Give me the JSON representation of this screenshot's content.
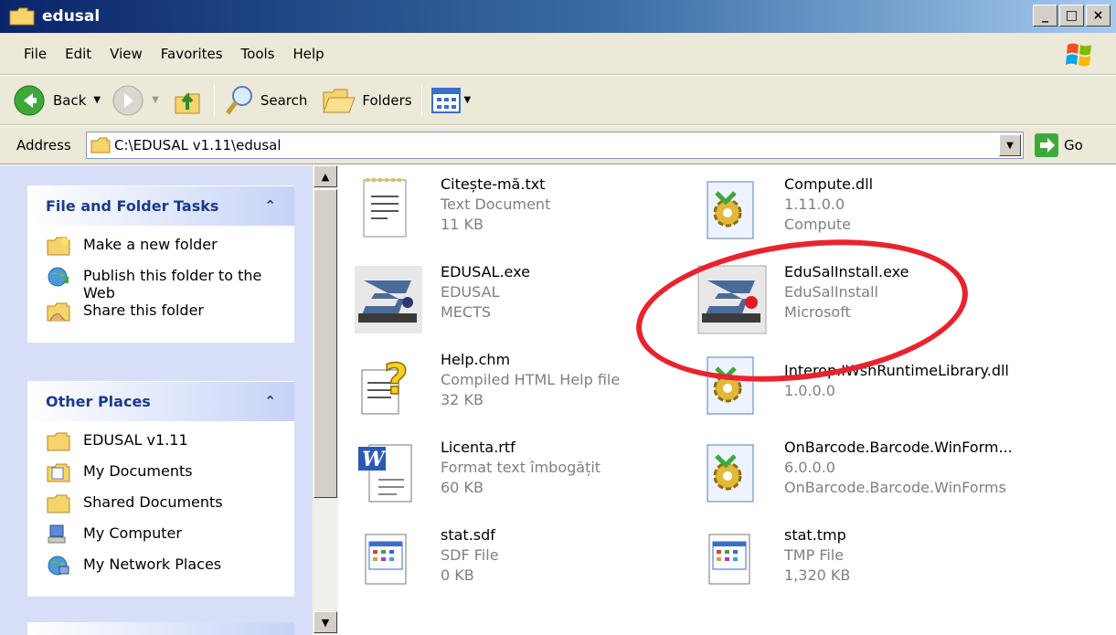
{
  "window": {
    "title": "edusal",
    "buttons": [
      "_",
      "□",
      "×"
    ]
  },
  "menu": [
    "File",
    "Edit",
    "View",
    "Favorites",
    "Tools",
    "Help"
  ],
  "toolbar": {
    "back": "Back",
    "search": "Search",
    "folders": "Folders"
  },
  "address": {
    "label": "Address",
    "path": "C:\\EDUSAL v1.11\\edusal",
    "go": "Go"
  },
  "tasks": {
    "title": "File and Folder Tasks",
    "items": [
      "Make a new folder",
      "Publish this folder to the Web",
      "Share this folder"
    ]
  },
  "places": {
    "title": "Other Places",
    "items": [
      "EDUSAL v1.11",
      "My Documents",
      "Shared Documents",
      "My Computer",
      "My Network Places"
    ]
  },
  "files": [
    {
      "name": "Citește-mă.txt",
      "l2": "Text Document",
      "l3": "11 KB",
      "icon": "text-file-icon"
    },
    {
      "name": "Compute.dll",
      "l2": "1.11.0.0",
      "l3": "Compute",
      "icon": "dll-gear-icon"
    },
    {
      "name": "EDUSAL.exe",
      "l2": "EDUSAL",
      "l3": "MECTS",
      "icon": "edusal-app-icon"
    },
    {
      "name": "EduSalInstall.exe",
      "l2": "EduSalInstall",
      "l3": "Microsoft",
      "icon": "edusal-install-icon"
    },
    {
      "name": "Help.chm",
      "l2": "Compiled HTML Help file",
      "l3": "32 KB",
      "icon": "help-file-icon"
    },
    {
      "name": "Interop.IWshRuntimeLibrary.dll",
      "l2": "1.0.0.0",
      "l3": "",
      "icon": "dll-gear-icon"
    },
    {
      "name": "Licenta.rtf",
      "l2": "Format text îmbogățit",
      "l3": "60 KB",
      "icon": "word-doc-icon"
    },
    {
      "name": "OnBarcode.Barcode.WinForm...",
      "l2": "6.0.0.0",
      "l3": "OnBarcode.Barcode.WinForms",
      "icon": "dll-gear-icon"
    },
    {
      "name": "stat.sdf",
      "l2": "SDF File",
      "l3": "0 KB",
      "icon": "generic-file-icon"
    },
    {
      "name": "stat.tmp",
      "l2": "TMP File",
      "l3": "1,320 KB",
      "icon": "generic-file-icon"
    }
  ]
}
